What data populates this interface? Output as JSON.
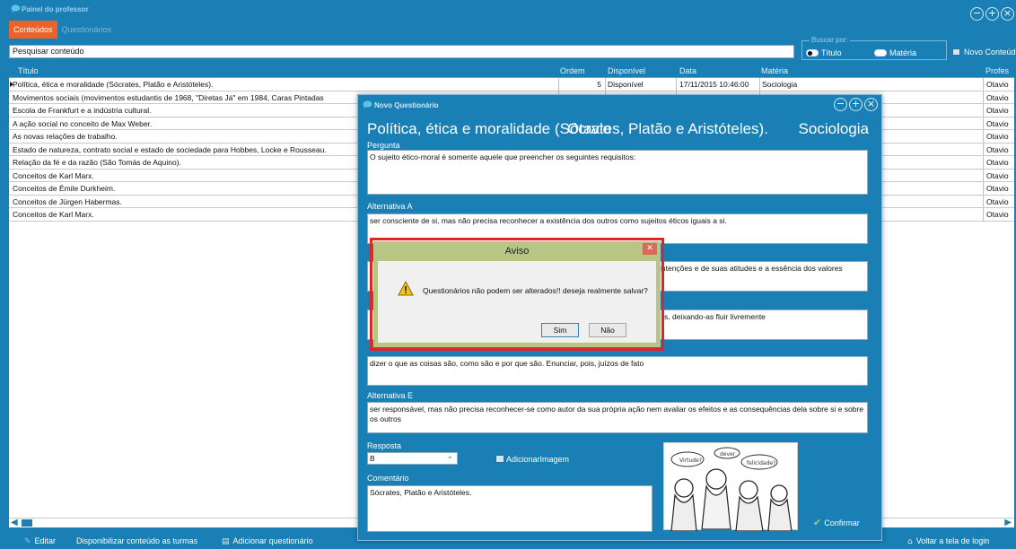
{
  "app": {
    "title": "Painel do professor"
  },
  "tabs": [
    {
      "label": "Conteúdos"
    },
    {
      "label": "Questionários"
    }
  ],
  "search": {
    "value": "Pesquisar conteúdo"
  },
  "buscar": {
    "label": "Buscar por:",
    "options": [
      "Título",
      "Matéria"
    ],
    "selected": "Título"
  },
  "toolbar": {
    "novo_label": "Novo Conteúdo"
  },
  "grid": {
    "columns": [
      "Título",
      "Ordem",
      "Disponível",
      "Data",
      "Matéria",
      "Profes"
    ],
    "rows": [
      {
        "titulo": "Política, ética e moralidade (Sócrates, Platão e Aristóteles).",
        "ordem": "5",
        "disponivel": "Disponível",
        "data": "17/11/2015 10:46:00",
        "materia": "Sociologia",
        "prof": "Otavio"
      },
      {
        "titulo": "Movimentos sociais (movimentos estudantis de 1968, \"Diretas Já\" em 1984, Caras Pintadas",
        "ordem": "",
        "disponivel": "",
        "data": "",
        "materia": "",
        "prof": "Otavio"
      },
      {
        "titulo": "Escola de Frankfurt e a indústria cultural.",
        "ordem": "",
        "disponivel": "",
        "data": "",
        "materia": "",
        "prof": "Otavio"
      },
      {
        "titulo": "A ação social no conceito de Max Weber.",
        "ordem": "",
        "disponivel": "",
        "data": "",
        "materia": "",
        "prof": "Otavio"
      },
      {
        "titulo": "As novas relações de trabalho.",
        "ordem": "",
        "disponivel": "",
        "data": "",
        "materia": "",
        "prof": "Otavio"
      },
      {
        "titulo": "Estado de natureza, contrato social e estado de sociedade para Hobbes, Locke e Rousseau.",
        "ordem": "",
        "disponivel": "",
        "data": "",
        "materia": "",
        "prof": "Otavio"
      },
      {
        "titulo": "Relação da fé e da razão (São Tomás de Aquino).",
        "ordem": "",
        "disponivel": "",
        "data": "",
        "materia": "",
        "prof": "Otavio"
      },
      {
        "titulo": "Conceitos de Karl Marx.",
        "ordem": "",
        "disponivel": "",
        "data": "",
        "materia": "",
        "prof": "Otavio"
      },
      {
        "titulo": "Conceitos de Émile Durkheim.",
        "ordem": "",
        "disponivel": "",
        "data": "",
        "materia": "",
        "prof": "Otavio"
      },
      {
        "titulo": "Conceitos de Jürgen Habermas.",
        "ordem": "",
        "disponivel": "",
        "data": "",
        "materia": "",
        "prof": "Otavio"
      },
      {
        "titulo": "Conceitos de Karl Marx.",
        "ordem": "",
        "disponivel": "",
        "data": "",
        "materia": "",
        "prof": "Otavio"
      }
    ]
  },
  "bottom": {
    "editar": "Editar",
    "disponibilizar": "Disponibilizar conteúdo as turmas",
    "adicionar": "Adicionar questionário",
    "voltar": "Voltar a tela de login"
  },
  "modal": {
    "title": "Novo Questionário",
    "heading": "Política, ética e moralidade (Sócrates, Platão e Aristóteles).",
    "overlap_text": "Otavio",
    "subject": "Sociologia",
    "pergunta_label": "Pergunta",
    "pergunta": "O sujeito ético-moral é somente aquele que preencher os seguintes requisitos:",
    "alt_a_label": "Alternativa A",
    "alt_a": "ser consciente de si, mas não precisa reconhecer a existência dos outros como sujeitos éticos iguais a si.",
    "alt_b": "intenções e de suas atitudes e a essência dos valores",
    "alt_c": "s, deixando-as fluir livremente",
    "alt_d": "dizer o que as coisas são, como são e por que são. Enunciar, pois, juízos de fato",
    "alt_e_label": "Alternativa E",
    "alt_e": "ser responsável, mas não precisa reconhecer-se como autor da sua própria ação nem avaliar os efeitos e as consequências dela sobre si e sobre os outros",
    "resposta_label": "Resposta",
    "resposta_value": "B",
    "add_image_label": "AdicionarImagem",
    "comentario_label": "Comentário",
    "comentario": "Sócrates, Platão e Aristóteles.",
    "confirm_label": "Confirmar",
    "cartoon_bubbles": [
      "Virtude?",
      "dever",
      "felicidade?"
    ]
  },
  "dialog": {
    "title": "Aviso",
    "message": "Questionários não podem ser alterados!! deseja realmente salvar?",
    "yes_label": "Sim",
    "no_label": "Não"
  },
  "colors": {
    "background": "#1a7fb5",
    "tab_active": "#e9632a",
    "dialog_frame": "#e0252a",
    "dialog_title": "#b9c585"
  }
}
